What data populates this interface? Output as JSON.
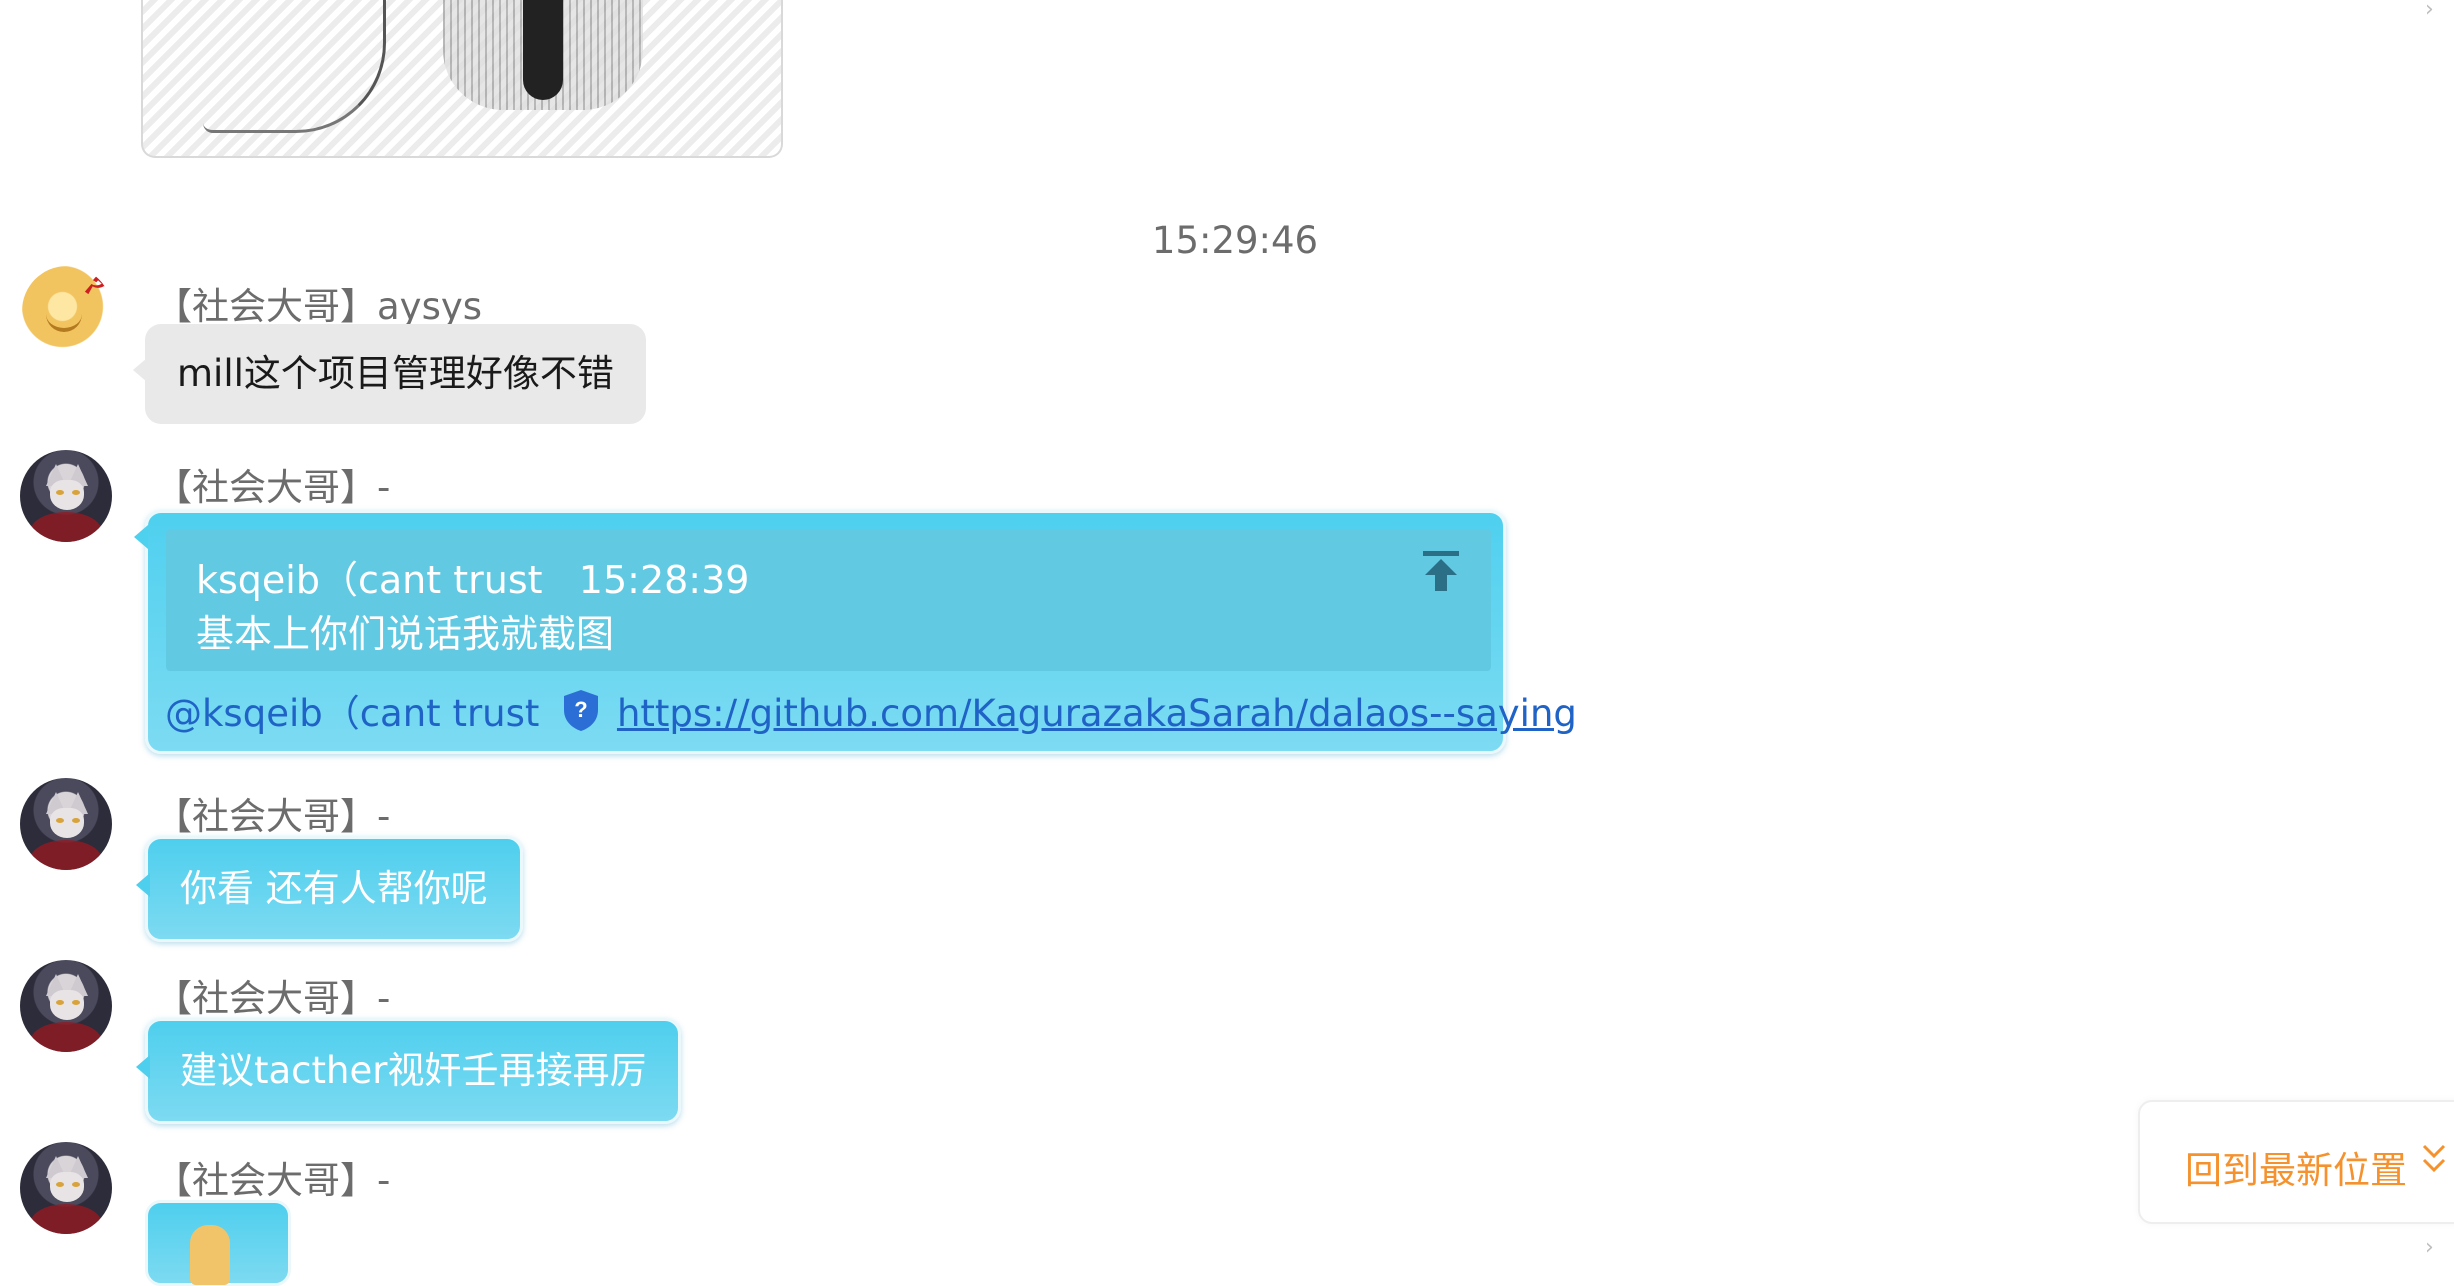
{
  "timestamp": "15:29:46",
  "messages": [
    {
      "sender": "【社会大哥】aysys",
      "text": "mill这个项目管理好像不错"
    },
    {
      "sender": "【社会大哥】-",
      "quote": {
        "author": "ksqeib（cant trust",
        "time": "15:28:39",
        "text": "基本上你们说话我就截图"
      },
      "mention": "@ksqeib（cant trust",
      "link": "https://github.com/KagurazakaSarah/dalaos--saying"
    },
    {
      "sender": "【社会大哥】-",
      "text": "你看 还有人帮你呢"
    },
    {
      "sender": "【社会大哥】-",
      "text": "建议tacther视奸壬再接再厉"
    },
    {
      "sender": "【社会大哥】-",
      "text": ""
    }
  ],
  "back_to_latest": "回到最新位置",
  "colors": {
    "bubble_blue": "#4ecfee",
    "bubble_gray": "#e9e9e9",
    "link": "#1f63c6",
    "back_to_latest": "#f5922e"
  }
}
